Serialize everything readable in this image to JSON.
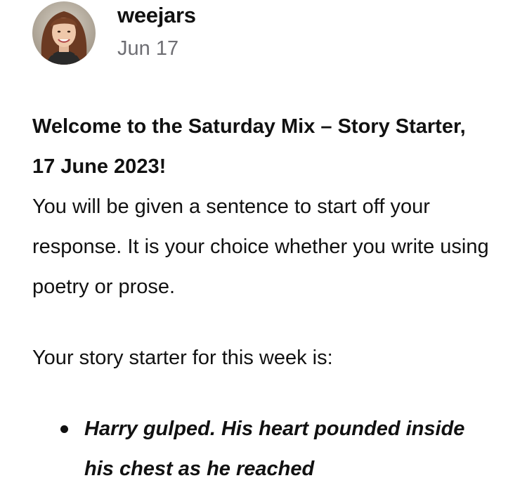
{
  "post": {
    "author": "weejars",
    "date": "Jun 17",
    "headline": "Welcome to the Saturday Mix – Story Starter, 17 June 2023!",
    "intro": "You will be given a sentence to start off your response. It is your choice whether you write using poetry or prose.",
    "starter_label": "Your story starter for this week is:",
    "bullets": [
      "Harry gulped. His heart pounded inside his chest as he reached"
    ]
  },
  "icons": {
    "bullet": "bullet-dot-icon",
    "avatar": "profile-photo"
  },
  "colors": {
    "text": "#111111",
    "date": "#6e6e73",
    "background": "#ffffff"
  }
}
